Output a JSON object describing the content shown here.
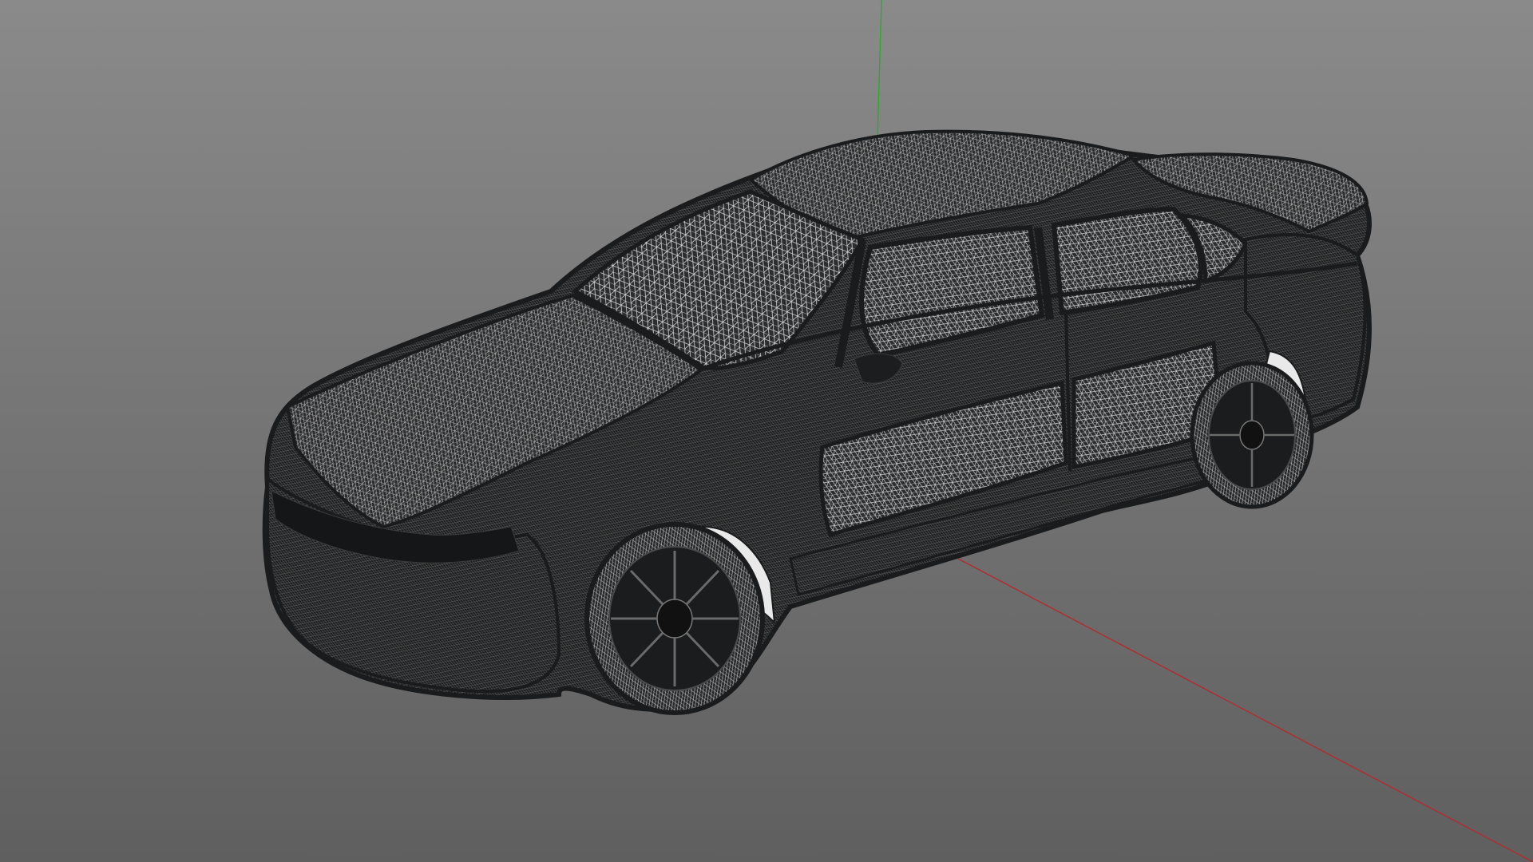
{
  "viewport": {
    "background_top": "#8a8a8a",
    "background_bottom": "#5f5f5f",
    "axis_x_color": "#b32c2c",
    "axis_y_color": "#2fa82f",
    "mesh_color": "#1f2021",
    "mesh_line_color": "#cfcfcf",
    "mesh_highlight": "#e9e9e9",
    "render_mode": "wireframe",
    "model": "sedan"
  }
}
